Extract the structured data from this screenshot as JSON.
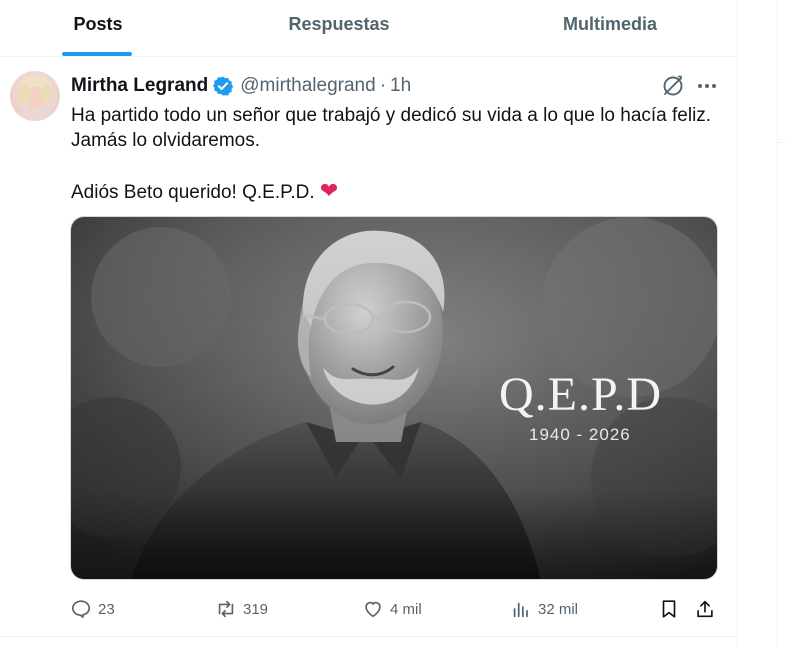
{
  "tabs": [
    {
      "label": "Posts",
      "active": true
    },
    {
      "label": "Respuestas",
      "active": false
    },
    {
      "label": "Multimedia",
      "active": false
    }
  ],
  "post": {
    "author_name": "Mirtha Legrand",
    "handle": "@mirthalegrand",
    "separator": "·",
    "time": "1h",
    "text_line1": "Ha partido todo un señor que trabajó y dedicó su vida a lo que lo hacía feliz.",
    "text_line2": "Jamás lo olvidaremos.",
    "text_line3": "Adiós Beto querido! Q.E.P.D.",
    "heart_emoji": "❤",
    "image": {
      "overlay_title": "Q.E.P.D",
      "overlay_years": "1940 - 2026"
    },
    "actions": {
      "replies": "23",
      "reposts": "319",
      "likes": "4 mil",
      "views": "32 mil"
    }
  },
  "colors": {
    "accent": "#1d9bf0",
    "text_primary": "#0f1419",
    "text_secondary": "#536471",
    "heart": "#e0245e"
  },
  "icons": [
    "verified-badge-icon",
    "grok-icon",
    "more-icon",
    "reply-icon",
    "repost-icon",
    "like-icon",
    "views-icon",
    "bookmark-icon",
    "share-icon"
  ]
}
